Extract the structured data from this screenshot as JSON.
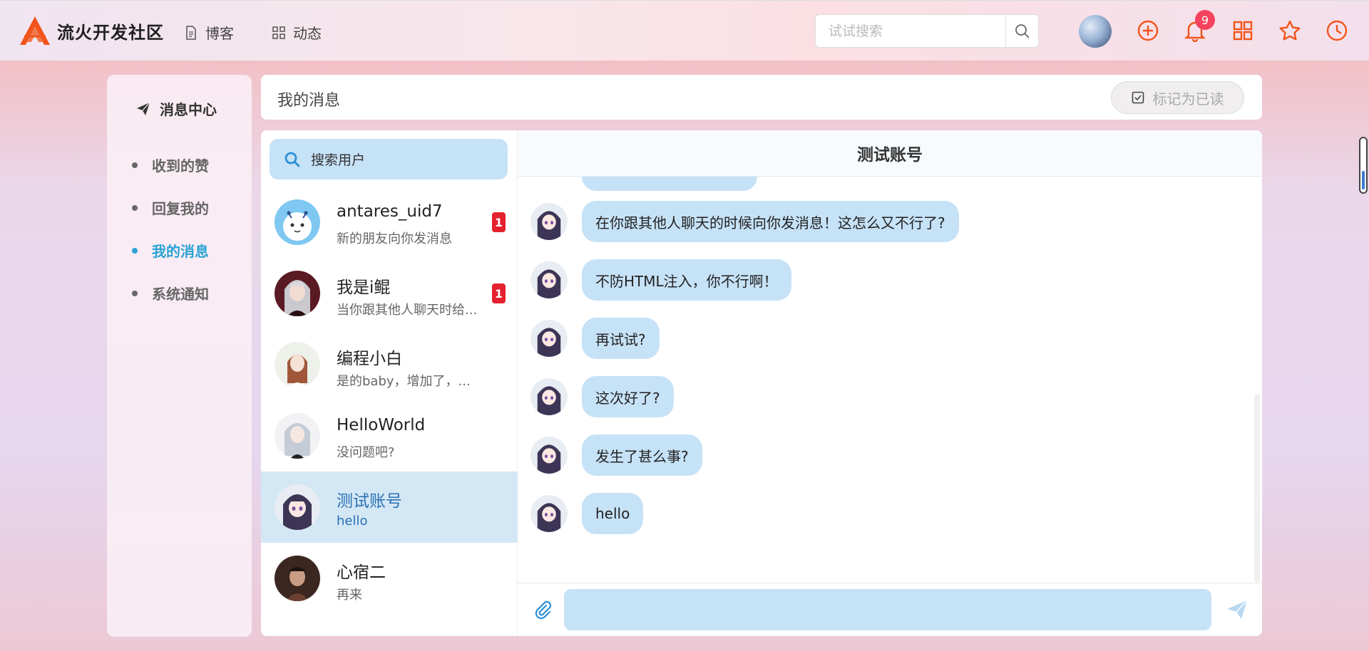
{
  "brand": {
    "name": "流火开发社区"
  },
  "nav": [
    {
      "label": "博客",
      "icon": "document-icon"
    },
    {
      "label": "动态",
      "icon": "grid-icon"
    }
  ],
  "search": {
    "placeholder": "试试搜索"
  },
  "notifications": {
    "count": "9"
  },
  "colors": {
    "accent": "#f2541b",
    "active": "#2aa3d5",
    "bubble": "#c6e2f7",
    "badge": "#e4212f"
  },
  "sidebar": {
    "title": "消息中心",
    "items": [
      {
        "label": "收到的赞",
        "active": false
      },
      {
        "label": "回复我的",
        "active": false
      },
      {
        "label": "我的消息",
        "active": true
      },
      {
        "label": "系统通知",
        "active": false
      }
    ]
  },
  "header": {
    "title": "我的消息",
    "mark_read": "标记为已读"
  },
  "contacts": {
    "search_placeholder": "搜索用户",
    "items": [
      {
        "name": "antares_uid7",
        "preview": "新的朋友向你发消息",
        "badge": "1",
        "active": false
      },
      {
        "name": "我是i鲲",
        "preview": "当你跟其他人聊天时给...",
        "badge": "1",
        "active": false
      },
      {
        "name": "编程小白",
        "preview": "是的baby，增加了，...",
        "badge": "",
        "active": false
      },
      {
        "name": "HelloWorld",
        "preview": "没问题吧?",
        "badge": "",
        "active": false
      },
      {
        "name": "测试账号",
        "preview": "hello",
        "badge": "",
        "active": true
      },
      {
        "name": "心宿二",
        "preview": "再来",
        "badge": "",
        "active": false
      }
    ]
  },
  "chat": {
    "title": "测试账号",
    "messages": [
      {
        "text": "在你跟其他人聊天的时候向你发消息！这怎么又不行了?"
      },
      {
        "text": "不防HTML注入，你不行啊！"
      },
      {
        "text": "再试试?"
      },
      {
        "text": "这次好了?"
      },
      {
        "text": "发生了甚么事?"
      },
      {
        "text": "hello"
      }
    ],
    "input_value": ""
  }
}
